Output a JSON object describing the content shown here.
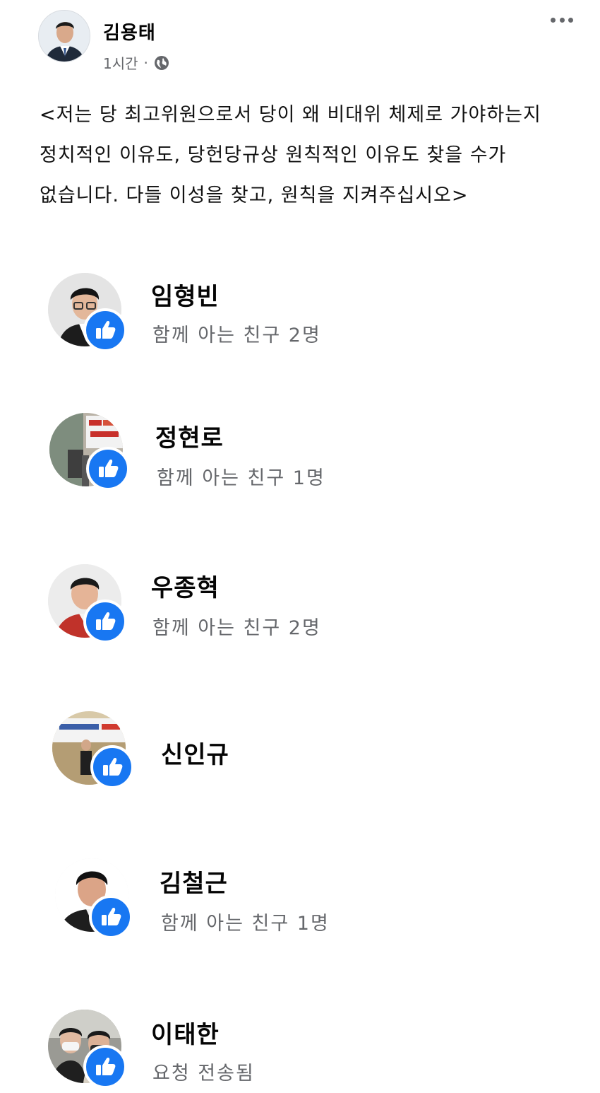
{
  "post": {
    "author": "김용태",
    "time": "1시간",
    "separator": "·",
    "privacy_icon": "globe-icon",
    "menu_icon": "more-horizontal-icon",
    "lines": [
      "<저는 당 최고위원으로서 당이 왜 비대위 체제로 가야하는지",
      "정치적인 이유도, 당헌당규상 원칙적인 이유도 찾을 수가",
      "없습니다. 다들 이성을 찾고, 원칙을 지켜주십시오>"
    ]
  },
  "reactions": [
    {
      "name": "임형빈",
      "subtitle": "함께 아는 친구 2명",
      "reaction_icon": "thumbs-up-icon"
    },
    {
      "name": "정현로",
      "subtitle": "함께 아는 친구 1명",
      "reaction_icon": "thumbs-up-icon"
    },
    {
      "name": "우종혁",
      "subtitle": "함께 아는 친구 2명",
      "reaction_icon": "thumbs-up-icon"
    },
    {
      "name": "신인규",
      "subtitle": "",
      "reaction_icon": "thumbs-up-icon"
    },
    {
      "name": "김철근",
      "subtitle": "함께 아는 친구 1명",
      "reaction_icon": "thumbs-up-icon"
    },
    {
      "name": "이태한",
      "subtitle": "요청 전송됨",
      "reaction_icon": "thumbs-up-icon"
    }
  ],
  "colors": {
    "like_badge": "#1877f2",
    "secondary_text": "#65676b"
  }
}
